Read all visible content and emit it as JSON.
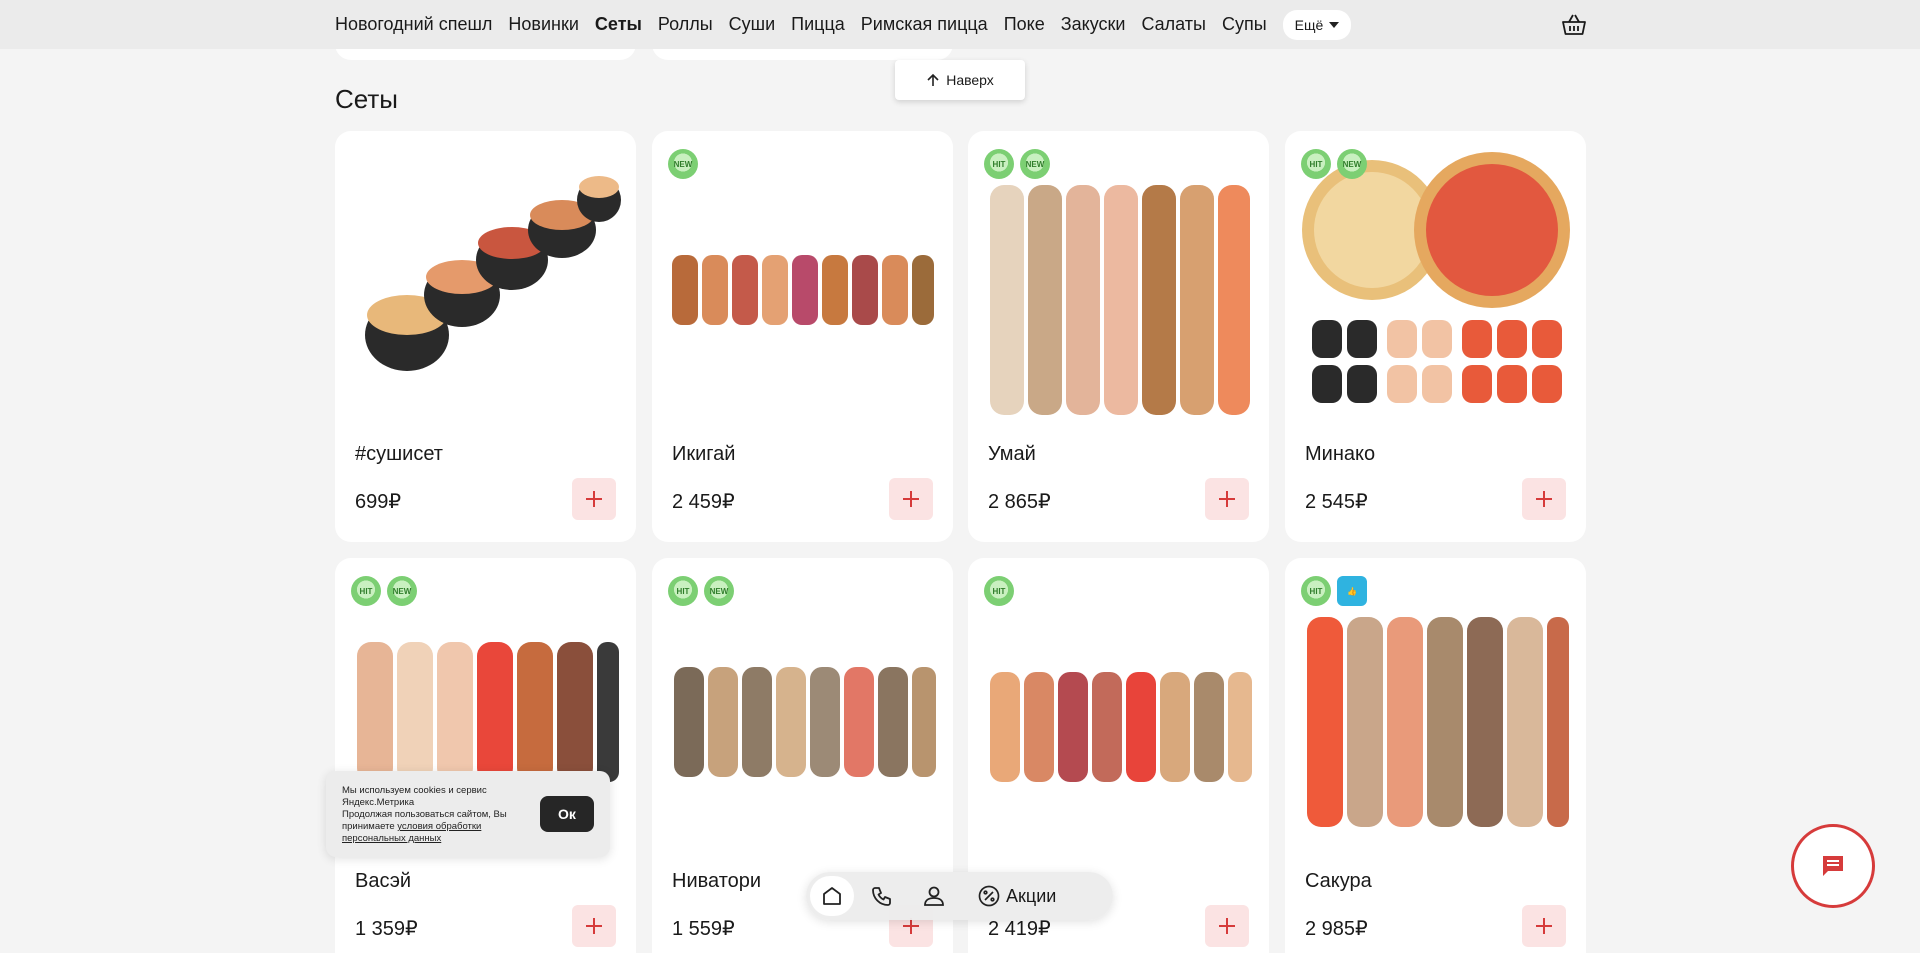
{
  "nav": {
    "items": [
      {
        "label": "Новогодний спешл",
        "active": false
      },
      {
        "label": "Новинки",
        "active": false
      },
      {
        "label": "Сеты",
        "active": true
      },
      {
        "label": "Роллы",
        "active": false
      },
      {
        "label": "Суши",
        "active": false
      },
      {
        "label": "Пицца",
        "active": false
      },
      {
        "label": "Римская пицца",
        "active": false
      },
      {
        "label": "Поке",
        "active": false
      },
      {
        "label": "Закуски",
        "active": false
      },
      {
        "label": "Салаты",
        "active": false
      },
      {
        "label": "Супы",
        "active": false
      }
    ],
    "more_label": "Ещё",
    "cart_icon": "basket-icon"
  },
  "up_button": {
    "label": "Наверх"
  },
  "section": {
    "title": "Сеты"
  },
  "products": [
    {
      "name": "#сушисет",
      "price": "699₽",
      "badges": []
    },
    {
      "name": "Икигай",
      "price": "2 459₽",
      "badges": [
        "NEW"
      ]
    },
    {
      "name": "Умай",
      "price": "2 865₽",
      "badges": [
        "HIT",
        "NEW"
      ]
    },
    {
      "name": "Минако",
      "price": "2 545₽",
      "badges": [
        "HIT",
        "NEW"
      ]
    },
    {
      "name": "Васэй",
      "price": "1 359₽",
      "badges": [
        "HIT",
        "NEW"
      ]
    },
    {
      "name": "Ниватори",
      "price": "1 559₽",
      "badges": [
        "HIT",
        "NEW"
      ]
    },
    {
      "name": "",
      "price": "2 419₽",
      "badges": [
        "HIT"
      ]
    },
    {
      "name": "Сакура",
      "price": "2 985₽",
      "badges": [
        "HIT",
        "LIKE"
      ]
    }
  ],
  "cookie": {
    "line1": "Мы используем cookies и сервис Яндекс.Метрика",
    "line2": "Продолжая пользоваться сайтом, Вы принимаете ",
    "link": "условия обработки персональных данных",
    "ok_label": "Ок"
  },
  "bottom_bar": {
    "promo_label": "Акции"
  },
  "colors": {
    "accent": "#d63b3b",
    "add_bg": "#fbe3e3",
    "page_bg": "#f4f4f4"
  }
}
